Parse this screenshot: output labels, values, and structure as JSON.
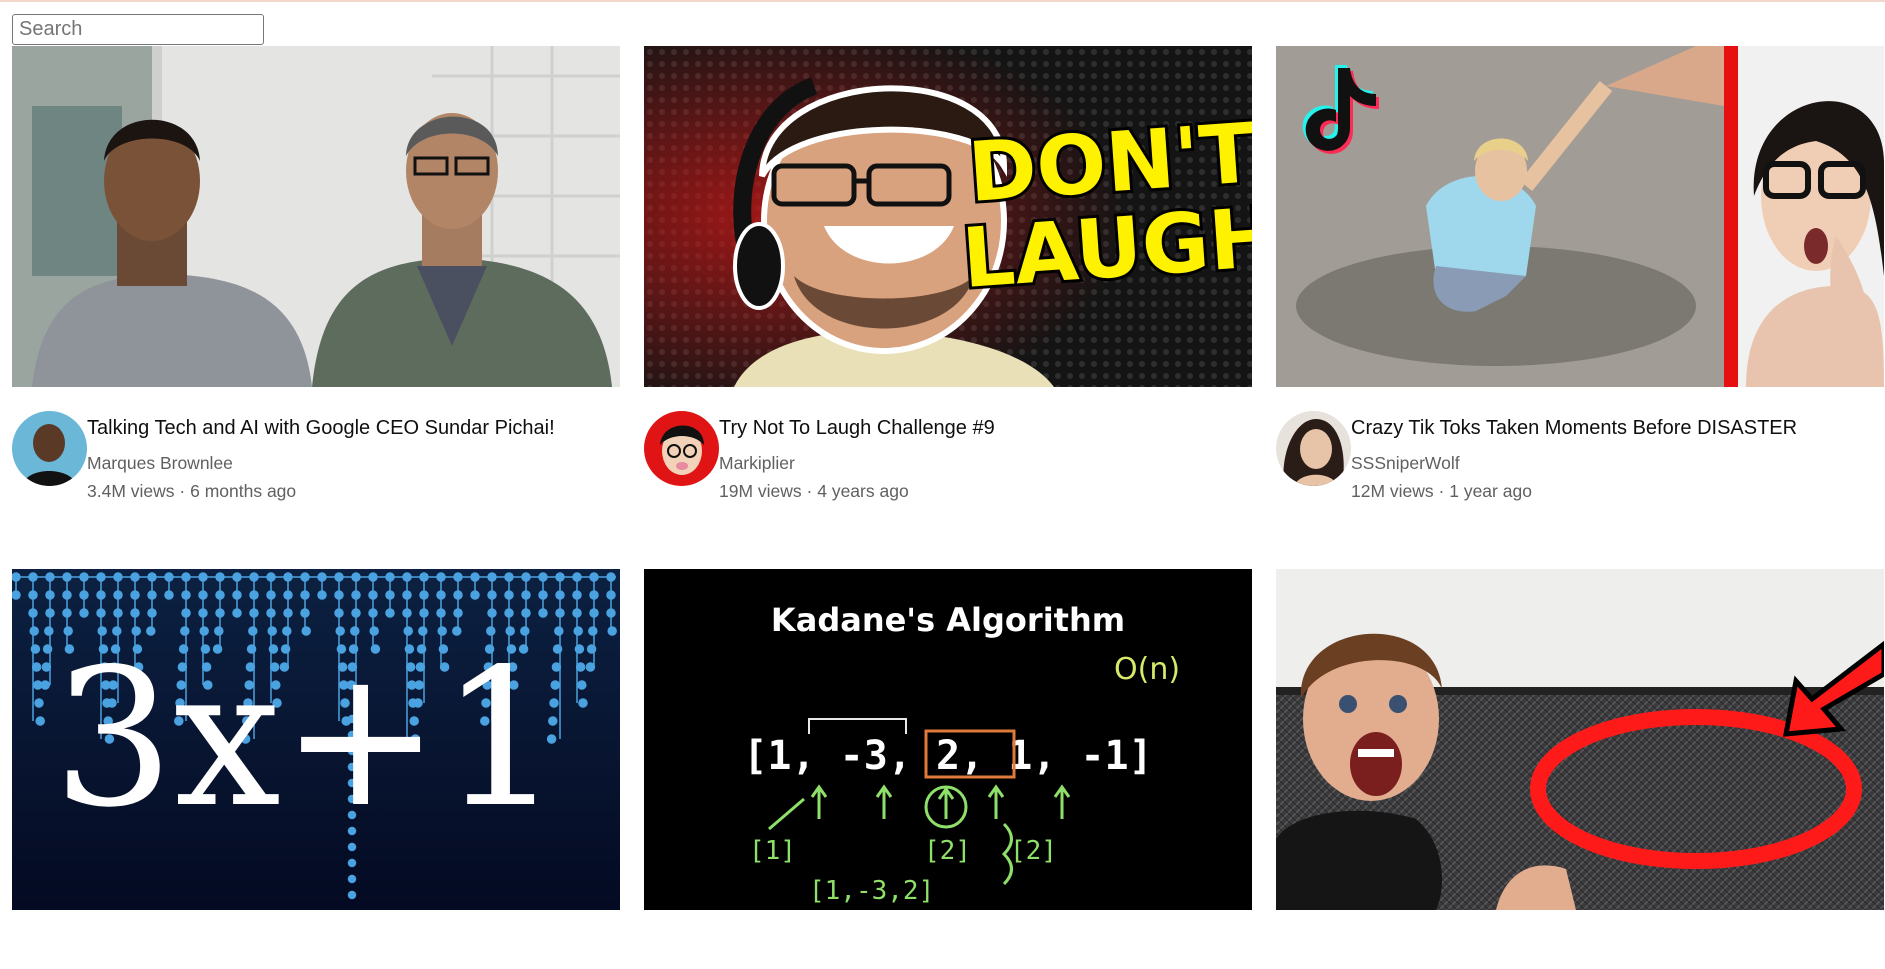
{
  "search": {
    "placeholder": "Search",
    "value": ""
  },
  "videos": [
    {
      "title": "Talking Tech and AI with Google CEO Sundar Pichai!",
      "channel": "Marques Brownlee",
      "views": "3.4M views",
      "age": "6 months ago",
      "thumb_text": ""
    },
    {
      "title": "Try Not To Laugh Challenge #9",
      "channel": "Markiplier",
      "views": "19M views",
      "age": "4 years ago",
      "thumb_text_1": "DON'T",
      "thumb_text_2": "LAUGH"
    },
    {
      "title": "Crazy Tik Toks Taken Moments Before DISASTER",
      "channel": "SSSniperWolf",
      "views": "12M views",
      "age": "1 year ago"
    },
    {
      "thumb_text": "3x+1"
    },
    {
      "thumb_title": "Kadane's Algorithm",
      "thumb_array": "[1, -3, 2, 1, -1]",
      "thumb_complexity": "O(n)",
      "thumb_sub1": "[1]",
      "thumb_sub2": "[2]",
      "thumb_sub3": "[2]",
      "thumb_sub4": "[1,-3,2]"
    },
    {
      "thumb_text": ""
    }
  ],
  "separator": " · "
}
